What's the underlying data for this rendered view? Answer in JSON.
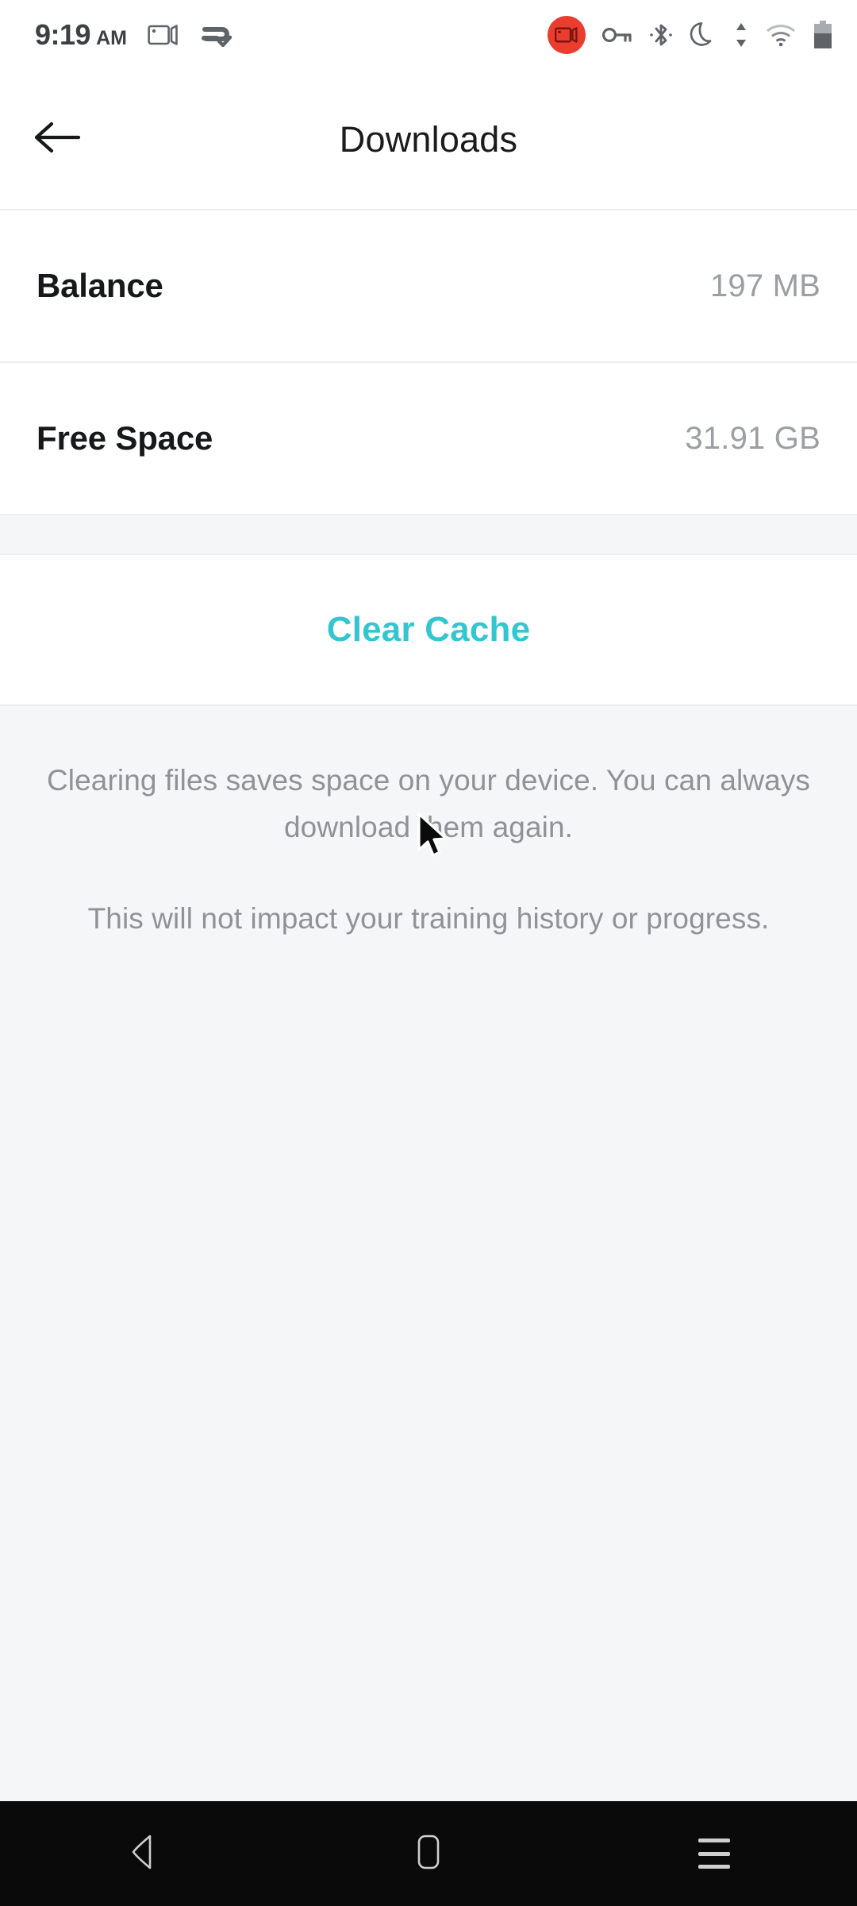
{
  "status_bar": {
    "time": "9:19",
    "meridiem": "AM",
    "icons": [
      "screen-record-outline-icon",
      "data-sync-check-icon",
      "screen-record-active-icon",
      "vpn-key-icon",
      "bluetooth-icon",
      "do-not-disturb-moon-icon",
      "data-transfer-icon",
      "wifi-icon",
      "battery-icon"
    ]
  },
  "app_bar": {
    "back_icon": "arrow-left-icon",
    "title": "Downloads"
  },
  "rows": [
    {
      "label": "Balance",
      "value": "197 MB"
    },
    {
      "label": "Free Space",
      "value": "31.91 GB"
    }
  ],
  "action": {
    "label": "Clear Cache",
    "color": "#34c6d0"
  },
  "description": {
    "paragraph_1": "Clearing files saves space on your device. You can always download them again.",
    "paragraph_2": "This will not impact your training history or progress."
  },
  "nav_bar": {
    "back": "nav-back-icon",
    "home": "nav-home-icon",
    "recents": "nav-recents-icon"
  },
  "colors": {
    "accent": "#34c6d0",
    "page_background": "#f5f6f8",
    "card_background": "#ffffff",
    "divider": "#ededf0",
    "muted_text": "#8f9296",
    "value_text": "#9b9ea3",
    "record_badge": "#ea3d2f"
  }
}
